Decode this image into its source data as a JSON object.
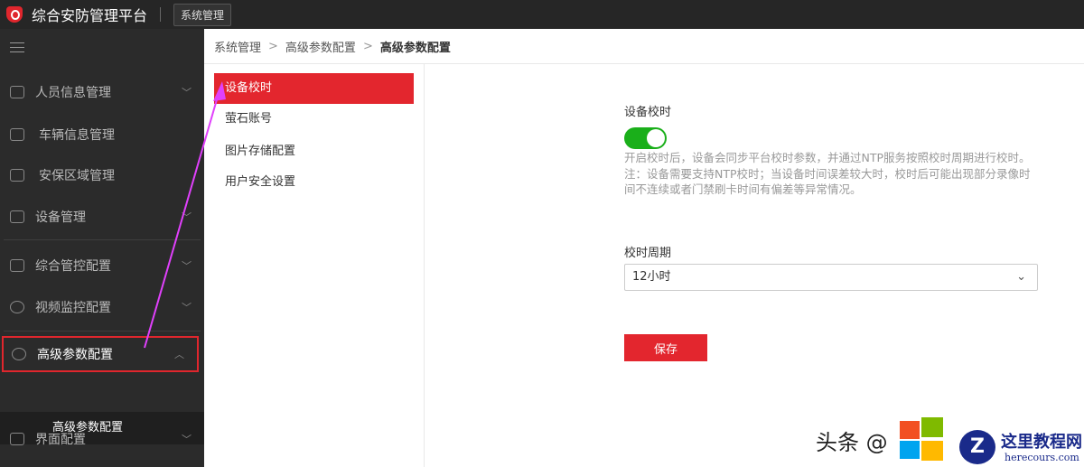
{
  "header": {
    "app_title": "综合安防管理平台",
    "system_button": "系统管理"
  },
  "sidebar": {
    "items": [
      {
        "label": "人员信息管理",
        "icon": "person-gear-icon",
        "chevron": "﹀"
      },
      {
        "label": "车辆信息管理",
        "icon": "car-icon"
      },
      {
        "label": "安保区域管理",
        "icon": "home-icon"
      },
      {
        "label": "设备管理",
        "icon": "device-icon",
        "chevron": "﹀"
      },
      {
        "label": "综合管控配置",
        "icon": "grid-icon",
        "chevron": "﹀"
      },
      {
        "label": "视频监控配置",
        "icon": "camera-icon",
        "chevron": "﹀"
      },
      {
        "label": "高级参数配置",
        "icon": "gear-icon",
        "chevron": "︿"
      },
      {
        "label": "界面配置",
        "icon": "screen-icon",
        "chevron": "﹀"
      }
    ],
    "sub_item": "高级参数配置"
  },
  "breadcrumb": {
    "items": [
      "系统管理",
      "高级参数配置",
      "高级参数配置"
    ],
    "sep": ">"
  },
  "submenu": [
    "设备校时",
    "萤石账号",
    "图片存储配置",
    "用户安全设置"
  ],
  "form": {
    "title": "设备校时",
    "toggle_on": true,
    "desc1": "开启校时后，设备会同步平台校时参数，并通过NTP服务按照校时周期进行校时。",
    "desc2": "注：设备需要支持NTP校时；当设备时间误差较大时，校时后可能出现部分录像时间不连续或者门禁刷卡时间有偏差等异常情况。",
    "period_label": "校时周期",
    "period_value": "12小时",
    "save": "保存"
  },
  "watermark": {
    "text": "头条 @",
    "site": "这里教程网",
    "url": "herecours.com"
  }
}
